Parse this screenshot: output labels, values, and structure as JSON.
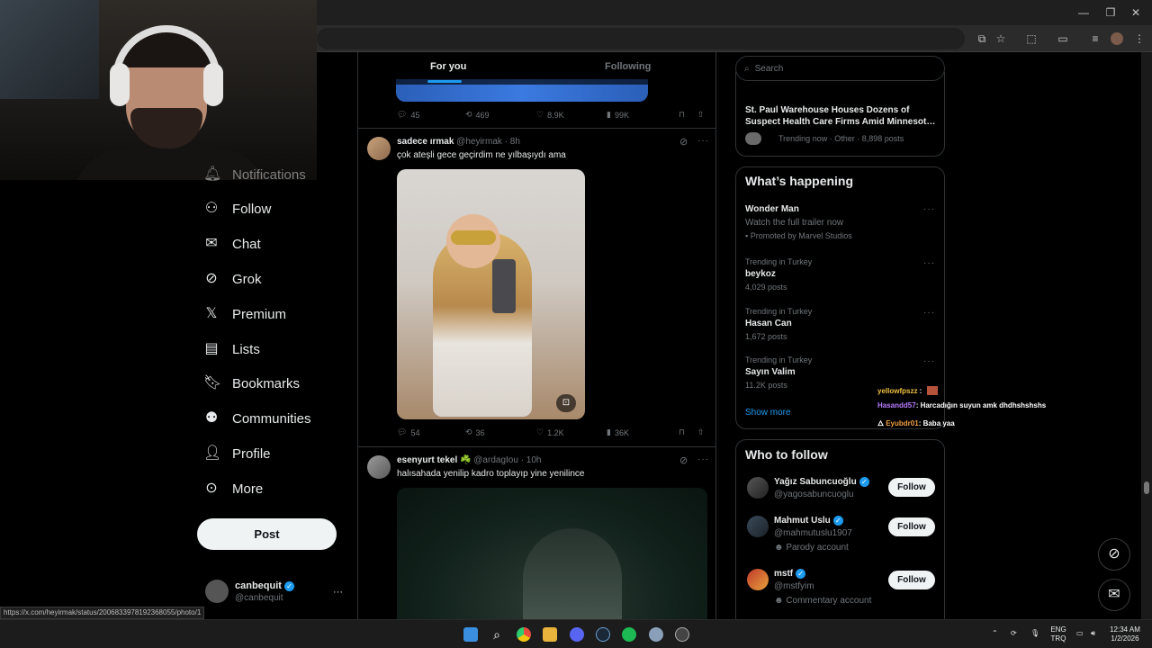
{
  "browser": {
    "window_controls": {
      "minimize": "—",
      "restore": "❐",
      "close": "✕"
    }
  },
  "nav": {
    "items": [
      {
        "label": "Notifications",
        "icon": "bell-icon"
      },
      {
        "label": "Follow",
        "icon": "follow-icon"
      },
      {
        "label": "Chat",
        "icon": "mail-icon"
      },
      {
        "label": "Grok",
        "icon": "grok-icon"
      },
      {
        "label": "Premium",
        "icon": "x-logo-icon"
      },
      {
        "label": "Lists",
        "icon": "list-icon"
      },
      {
        "label": "Bookmarks",
        "icon": "bookmark-icon"
      },
      {
        "label": "Communities",
        "icon": "communities-icon"
      },
      {
        "label": "Profile",
        "icon": "profile-icon"
      },
      {
        "label": "More",
        "icon": "more-circle-icon"
      }
    ],
    "post_button": "Post",
    "account": {
      "name": "canbequit",
      "handle": "@canbequit",
      "menu": "···"
    }
  },
  "feed": {
    "tabs": [
      {
        "label": "For you",
        "active": true
      },
      {
        "label": "Following",
        "active": false
      }
    ],
    "post0": {
      "replies": "45",
      "reposts": "469",
      "likes": "8.9K",
      "views": "99K"
    },
    "post1": {
      "name": "sadece ırmak",
      "handle": "@heyirmak",
      "time": "· 8h",
      "text": "çok ateşli gece geçirdim ne yılbaşıydı ama",
      "replies": "54",
      "reposts": "36",
      "likes": "1.2K",
      "views": "36K"
    },
    "post2": {
      "name": "esenyurt tekel ☘️",
      "handle": "@ardagIou",
      "time": "· 10h",
      "text": "halısahada yenilip kadro toplayıp yine yenilince"
    }
  },
  "right": {
    "search_placeholder": "Search",
    "top_trend": {
      "title": "St. Paul Warehouse Houses Dozens of Suspect Health Care Firms Amid Minnesot…",
      "meta": "Trending now · Other · 8,898 posts"
    },
    "whats_happening": {
      "heading": "What’s happening",
      "items": [
        {
          "label": "",
          "title": "Wonder Man",
          "sub": "Watch the full trailer now",
          "promo": "Promoted by Marvel Studios"
        },
        {
          "label": "Trending in Turkey",
          "title": "beykoz",
          "sub": "4,029 posts"
        },
        {
          "label": "Trending in Turkey",
          "title": "Hasan Can",
          "sub": "1,672 posts"
        },
        {
          "label": "Trending in Turkey",
          "title": "Sayın Valim",
          "sub": "11.2K posts"
        }
      ],
      "show_more": "Show more"
    },
    "who_to_follow": {
      "heading": "Who to follow",
      "button": "Follow",
      "users": [
        {
          "name": "Yağız Sabuncuoğlu",
          "handle": "@yagosabuncuoglu",
          "note": ""
        },
        {
          "name": "Mahmut Uslu",
          "handle": "@mahmutuslu1907",
          "note": "Parody account"
        },
        {
          "name": "mstf",
          "handle": "@mstfyim",
          "note": "Commentary account"
        }
      ]
    }
  },
  "chat_overlay": [
    {
      "user": "yellowfpszz",
      "message": "",
      "color": "#f0c040"
    },
    {
      "user": "Hasandd57",
      "message": ": Harcadığın suyun amk dhdhshshshs",
      "color": "#b67cff"
    },
    {
      "user": "Eyubdr01",
      "message": ": Baba yaa",
      "color": "#f0a040"
    }
  ],
  "status_url": "https://x.com/heyirmak/status/2006833978192368055/photo/1",
  "taskbar": {
    "lang": "ENG",
    "lang2": "TRQ",
    "time": "12:34 AM",
    "date": "1/2/2026"
  },
  "colors": {
    "accent": "#1d9bf0",
    "background": "#000000",
    "border": "#2f3336"
  }
}
